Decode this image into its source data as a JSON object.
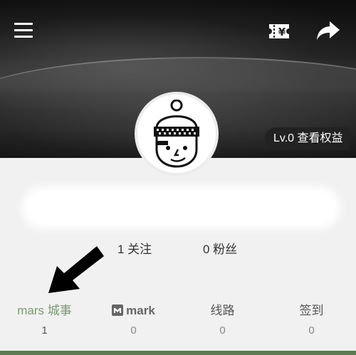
{
  "header": {
    "menu_icon": "hamburger-menu-icon",
    "ticket_icon": "yen-ticket-icon",
    "share_icon": "share-arrow-icon"
  },
  "profile": {
    "level_badge": "Lv.0 查看权益",
    "avatar": "cartoon-boy-with-beanie-avatar"
  },
  "stats": {
    "following": "1 关注",
    "followers": "0 粉丝"
  },
  "tabs": [
    {
      "label": "mars 城事",
      "count": "1",
      "active": true
    },
    {
      "label": "mark",
      "count": "0",
      "icon": "mark-logo-icon"
    },
    {
      "label": "线路",
      "count": "0"
    },
    {
      "label": "签到",
      "count": "0"
    }
  ],
  "colors": {
    "accent": "#7d9773",
    "bottom_bar": "#5d7a53",
    "badge_bg": "#222222",
    "page_bg": "#f1f1f1"
  }
}
